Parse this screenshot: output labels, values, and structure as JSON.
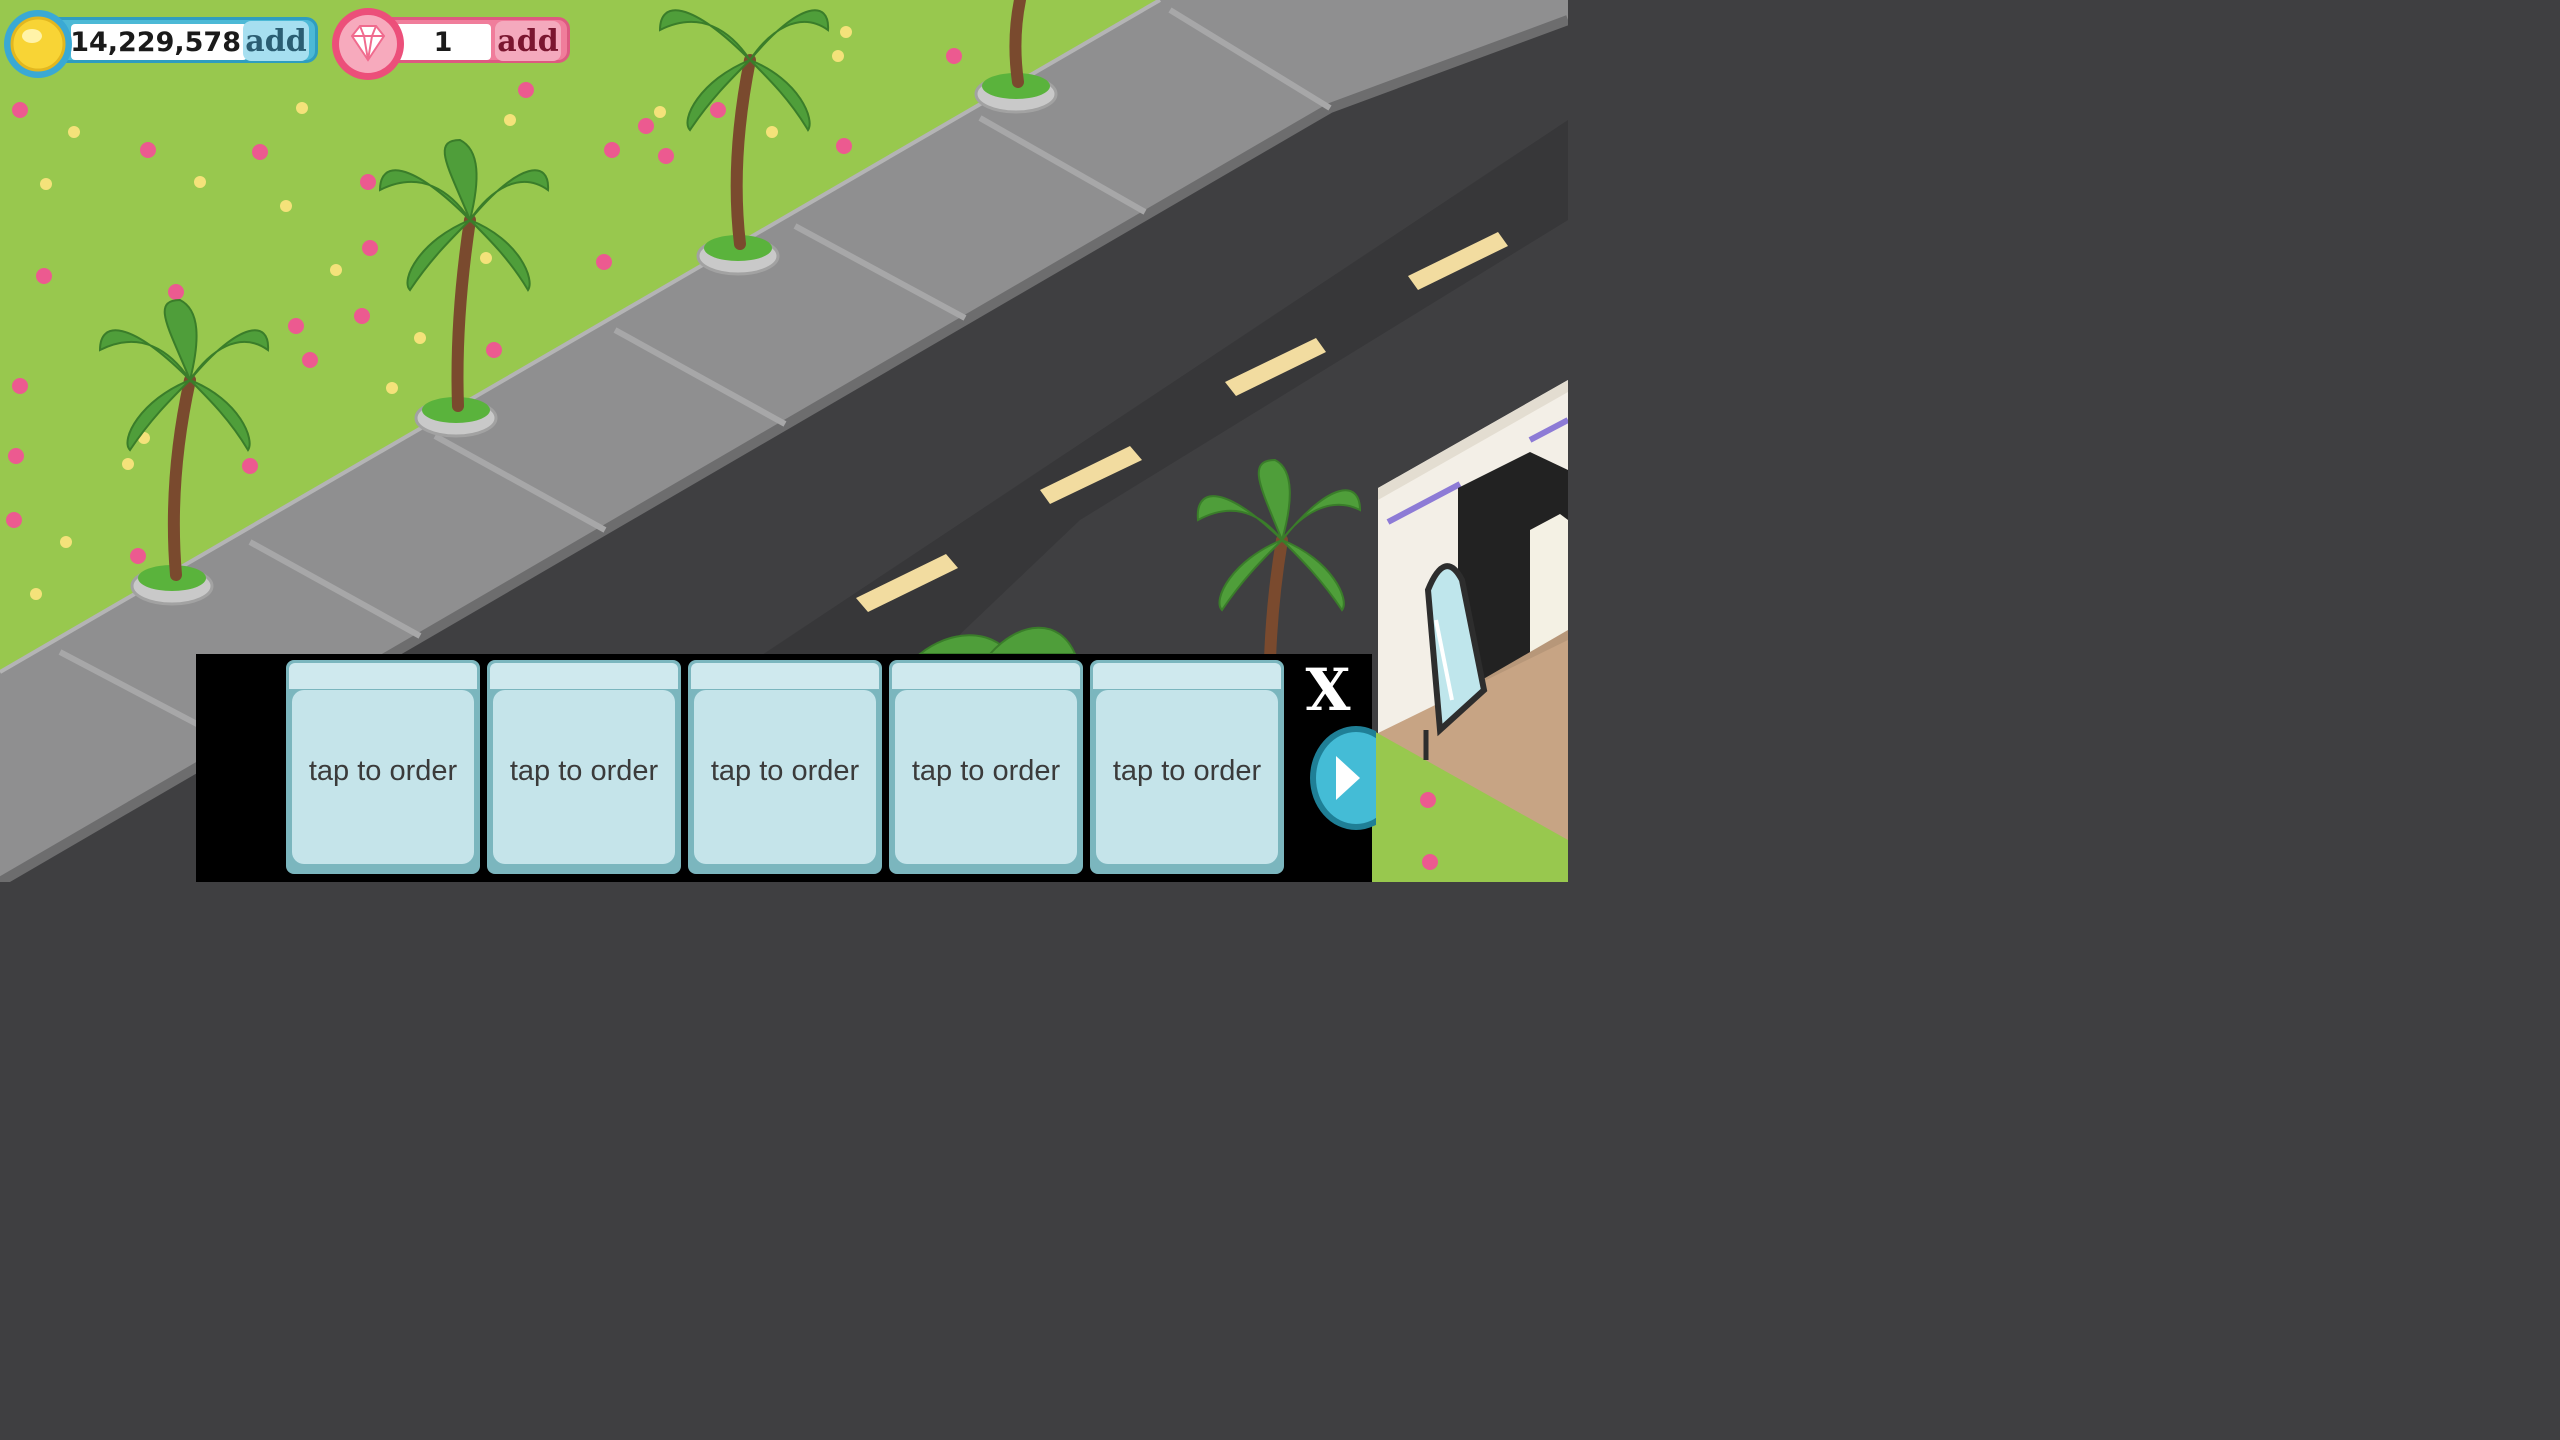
{
  "hud": {
    "coins": {
      "value": "14,229,578",
      "add_label": "add",
      "icon": "coin-icon"
    },
    "gems": {
      "value": "1",
      "add_label": "add",
      "icon": "diamond-icon"
    }
  },
  "order_bar": {
    "slots": [
      {
        "label": "tap to order"
      },
      {
        "label": "tap to order"
      },
      {
        "label": "tap to order"
      },
      {
        "label": "tap to order"
      },
      {
        "label": "tap to order"
      }
    ],
    "close_label": "X",
    "next_icon": "arrow-right-icon"
  },
  "colors": {
    "grass": "#98c84e",
    "sidewalk": "#8f8f90",
    "road": "#3f3f41",
    "lane_marking": "#f2dca0",
    "coins_accent": "#4cb9d6",
    "gems_accent": "#f07d9b",
    "order_slot": "#c5e4ea"
  }
}
